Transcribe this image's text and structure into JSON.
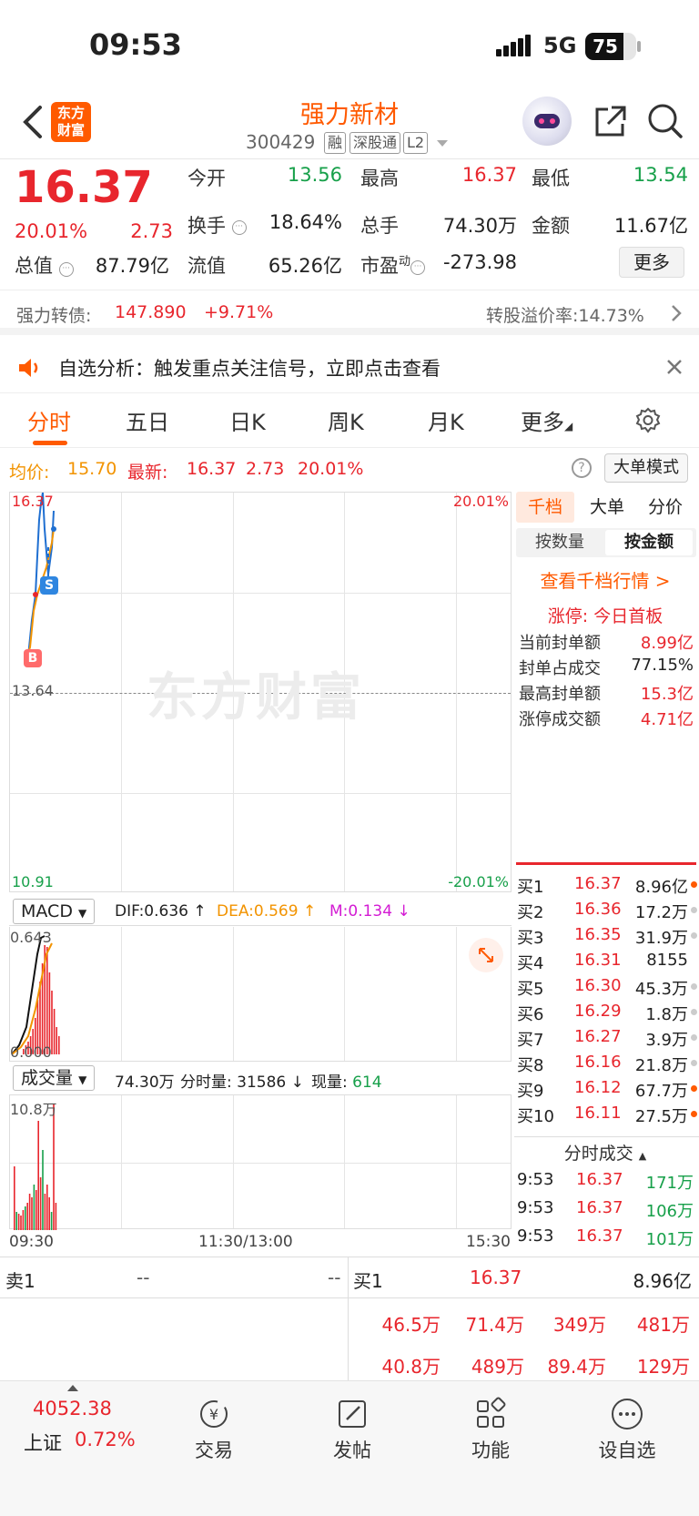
{
  "status_bar": {
    "time": "09:53",
    "network": "5G",
    "battery": "75",
    "battery_level": 0.75
  },
  "header": {
    "logo_line1": "东方",
    "logo_line2": "财富",
    "name": "强力新材",
    "code": "300429",
    "tags": [
      "融",
      "深股通",
      "L2"
    ]
  },
  "quote": {
    "price": "16.37",
    "change_pct": "20.01%",
    "change": "2.73",
    "open_label": "今开",
    "open": "13.56",
    "high_label": "最高",
    "high": "16.37",
    "low_label": "最低",
    "low": "13.54",
    "turnover_label": "换手",
    "turnover": "18.64%",
    "volume_label": "总手",
    "volume": "74.30万",
    "amount_label": "金额",
    "amount": "11.67亿",
    "mcap_label": "总值",
    "mcap": "87.79亿",
    "float_label": "流值",
    "float_mcap": "65.26亿",
    "pe_label": "市盈",
    "pe_sup": "动",
    "pe": "-273.98",
    "more": "更多"
  },
  "bond": {
    "label": "强力转债:",
    "price": "147.890",
    "change": "+9.71%",
    "premium": "转股溢价率:14.73%"
  },
  "notice": {
    "text": "自选分析：触发重点关注信号，立即点击查看"
  },
  "tabs": [
    "分时",
    "五日",
    "日K",
    "周K",
    "月K",
    "更多"
  ],
  "info": {
    "avg_label": "均价:",
    "avg": "15.70",
    "latest_label": "最新:",
    "latest": "16.37",
    "chg": "2.73",
    "pct": "20.01%",
    "mode": "大单模式"
  },
  "chart": {
    "top_price": "16.37",
    "mid_price": "13.64",
    "bottom_price": "10.91",
    "top_pct": "20.01%",
    "bottom_pct": "-20.01%",
    "watermark": "东方财富",
    "buy_marker": "B",
    "sell_marker": "S"
  },
  "panel": {
    "tabs": [
      "千档",
      "大单",
      "分价"
    ],
    "subtabs": [
      "按数量",
      "按金额"
    ],
    "link": "查看千档行情 >",
    "limit_title": "涨停: 今日首板",
    "stats": [
      {
        "label": "当前封单额",
        "value": "8.99亿"
      },
      {
        "label": "封单占成交",
        "value": "77.15%"
      },
      {
        "label": "最高封单额",
        "value": "15.3亿"
      },
      {
        "label": "涨停成交额",
        "value": "4.71亿"
      }
    ],
    "bids": [
      {
        "label": "买1",
        "price": "16.37",
        "vol": "8.96亿",
        "dot": "#ff5a00"
      },
      {
        "label": "买2",
        "price": "16.36",
        "vol": "17.2万",
        "dot": "#ccc"
      },
      {
        "label": "买3",
        "price": "16.35",
        "vol": "31.9万",
        "dot": "#ccc"
      },
      {
        "label": "买4",
        "price": "16.31",
        "vol": "8155",
        "dot": ""
      },
      {
        "label": "买5",
        "price": "16.30",
        "vol": "45.3万",
        "dot": "#ccc"
      },
      {
        "label": "买6",
        "price": "16.29",
        "vol": "1.8万",
        "dot": "#ccc"
      },
      {
        "label": "买7",
        "price": "16.27",
        "vol": "3.9万",
        "dot": "#ccc"
      },
      {
        "label": "买8",
        "price": "16.16",
        "vol": "21.8万",
        "dot": "#ccc"
      },
      {
        "label": "买9",
        "price": "16.12",
        "vol": "67.7万",
        "dot": "#ff5a00"
      },
      {
        "label": "买10",
        "price": "16.11",
        "vol": "27.5万",
        "dot": "#ff5a00"
      }
    ],
    "ticks_title": "分时成交",
    "ticks": [
      {
        "time": "9:53",
        "price": "16.37",
        "vol": "171万"
      },
      {
        "time": "9:53",
        "price": "16.37",
        "vol": "106万"
      },
      {
        "time": "9:53",
        "price": "16.37",
        "vol": "101万"
      }
    ]
  },
  "macd": {
    "select": "MACD",
    "dif": "DIF:0.636 ↑",
    "dea": "DEA:0.569 ↑",
    "m": "M:0.134 ↓",
    "top": "0.643",
    "bottom": "0.000"
  },
  "volume": {
    "select": "成交量",
    "total": "74.30万",
    "minute": "分时量: 31586 ↓",
    "now_label": "现量:",
    "now": "614",
    "top": "10.8万"
  },
  "time_axis": {
    "start": "09:30",
    "mid": "11:30/13:00",
    "end": "15:30"
  },
  "strip": {
    "sell_label": "卖1",
    "sell_dash1": "--",
    "sell_dash2": "--",
    "buy_label": "买1",
    "buy_price": "16.37",
    "buy_vol": "8.96亿",
    "row1": [
      "46.5万",
      "71.4万",
      "349万",
      "481万"
    ],
    "row2": [
      "40.8万",
      "489万",
      "89.4万",
      "129万"
    ]
  },
  "nav": {
    "index_value": "4052.38",
    "index_name": "上证",
    "index_pct": "0.72%",
    "items": [
      "交易",
      "发帖",
      "功能",
      "设自选"
    ]
  }
}
